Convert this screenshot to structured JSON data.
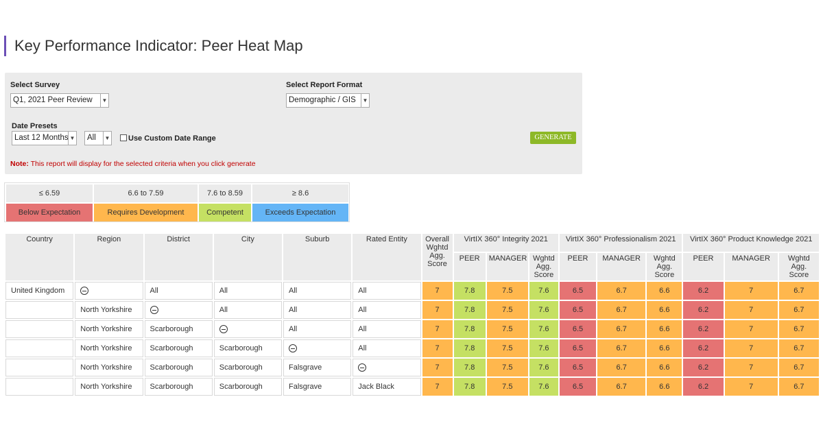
{
  "page_title": "Key Performance Indicator: Peer Heat Map",
  "filters": {
    "survey_label": "Select Survey",
    "survey_value": "Q1, 2021 Peer Review",
    "format_label": "Select Report Format",
    "format_value": "Demographic / GIS",
    "presets_label": "Date Presets",
    "preset_value": "Last 12 Months",
    "period_value": "All",
    "custom_range_label": "Use Custom Date Range",
    "generate_label": "GENERATE",
    "note_prefix": "Note:",
    "note_text": " This report will display for the selected criteria when you click generate"
  },
  "legend": [
    {
      "range": "≤ 6.59",
      "label": "Below Expectation",
      "color": "#e57373"
    },
    {
      "range": "6.6 to 7.59",
      "label": "Requires Development",
      "color": "#ffb74d"
    },
    {
      "range": "7.6 to 8.59",
      "label": "Competent",
      "color": "#c5e063"
    },
    {
      "range": "≥ 8.6",
      "label": "Exceeds Expectation",
      "color": "#64b5f6"
    }
  ],
  "table": {
    "headers": {
      "country": "Country",
      "region": "Region",
      "district": "District",
      "city": "City",
      "suburb": "Suburb",
      "rated_entity": "Rated Entity",
      "overall": "Overall Wghtd Agg. Score",
      "group1": "VirtIX 360° Integrity 2021",
      "group2": "VirtIX 360° Professionalism 2021",
      "group3": "VirtIX 360° Product Knowledge 2021",
      "peer": "PEER",
      "manager": "MANAGER",
      "wghtd_agg": "Wghtd Agg. Score",
      "wghtd_agg_short": "Wghtd Agg. Score"
    },
    "rows": [
      {
        "country": "United Kingdom",
        "region": "",
        "district": "All",
        "city": "All",
        "suburb": "All",
        "entity": "All",
        "collapse_col": "region",
        "scores": [
          "7",
          "7.8",
          "7.5",
          "7.6",
          "6.5",
          "6.7",
          "6.6",
          "6.2",
          "7",
          "6.7"
        ]
      },
      {
        "country": "",
        "region": "North Yorkshire",
        "district": "",
        "city": "All",
        "suburb": "All",
        "entity": "All",
        "collapse_col": "district",
        "scores": [
          "7",
          "7.8",
          "7.5",
          "7.6",
          "6.5",
          "6.7",
          "6.6",
          "6.2",
          "7",
          "6.7"
        ]
      },
      {
        "country": "",
        "region": "North Yorkshire",
        "district": "Scarborough",
        "city": "",
        "suburb": "All",
        "entity": "All",
        "collapse_col": "city",
        "scores": [
          "7",
          "7.8",
          "7.5",
          "7.6",
          "6.5",
          "6.7",
          "6.6",
          "6.2",
          "7",
          "6.7"
        ]
      },
      {
        "country": "",
        "region": "North Yorkshire",
        "district": "Scarborough",
        "city": "Scarborough",
        "suburb": "",
        "entity": "All",
        "collapse_col": "suburb",
        "scores": [
          "7",
          "7.8",
          "7.5",
          "7.6",
          "6.5",
          "6.7",
          "6.6",
          "6.2",
          "7",
          "6.7"
        ]
      },
      {
        "country": "",
        "region": "North Yorkshire",
        "district": "Scarborough",
        "city": "Scarborough",
        "suburb": "Falsgrave",
        "entity": "",
        "collapse_col": "entity",
        "scores": [
          "7",
          "7.8",
          "7.5",
          "7.6",
          "6.5",
          "6.7",
          "6.6",
          "6.2",
          "7",
          "6.7"
        ]
      },
      {
        "country": "",
        "region": "North Yorkshire",
        "district": "Scarborough",
        "city": "Scarborough",
        "suburb": "Falsgrave",
        "entity": "Jack Black",
        "collapse_col": "",
        "scores": [
          "7",
          "7.8",
          "7.5",
          "7.6",
          "6.5",
          "6.7",
          "6.6",
          "6.2",
          "7",
          "6.7"
        ]
      }
    ]
  }
}
